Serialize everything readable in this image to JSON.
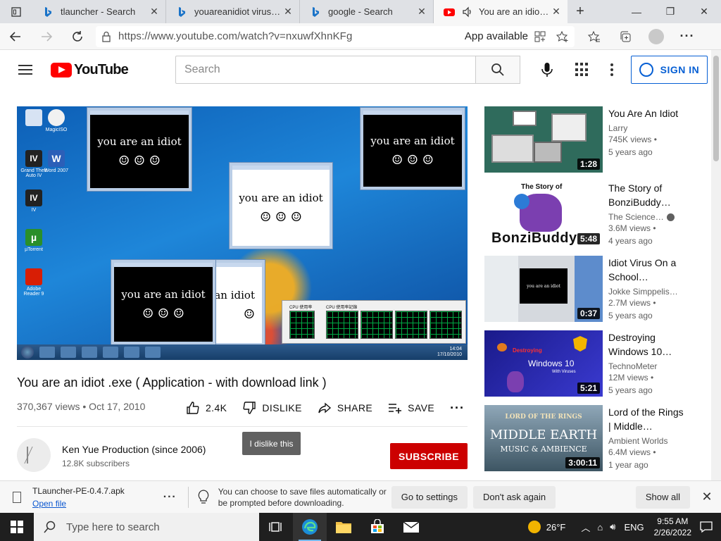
{
  "browser": {
    "tabs": [
      {
        "title": "tlauncher - Search",
        "favicon": "bing-icon",
        "active": false
      },
      {
        "title": "youareanidiot virus dow",
        "favicon": "bing-icon",
        "active": false
      },
      {
        "title": "google - Search",
        "favicon": "bing-icon",
        "active": false
      },
      {
        "title": "You are an idiot .e",
        "favicon": "youtube-icon",
        "active": true
      }
    ],
    "url": "https://www.youtube.com/watch?v=nxuwfXhnKFg",
    "app_available": "App available"
  },
  "youtube": {
    "logo_text": "YouTube",
    "search_placeholder": "Search",
    "sign_in": "SIGN IN",
    "video": {
      "title": "You are an idiot .exe ( Application - with download link )",
      "meta": "370,367 views • Oct 17, 2010",
      "likes": "2.4K",
      "dislike": "DISLIKE",
      "share": "SHARE",
      "save": "SAVE",
      "overlay": {
        "message": "you are an idiot",
        "message_partial": "an idiot",
        "smiles": "☺ ☺ ☺",
        "desktop_icons": [
          "",
          "MagicISO",
          "Grand Theft Auto IV",
          "Word 2007",
          "IV",
          "µTorrent",
          "Adobe Reader 9"
        ],
        "cpu_label_1": "CPU 使用率",
        "cpu_label_2": "CPU 使用率記錄",
        "clock_time": "14:04",
        "clock_date": "17/10/2010"
      }
    },
    "channel": {
      "name": "Ken Yue Production (since 2006)",
      "subs": "12.8K subscribers",
      "subscribe": "SUBSCRIBE"
    },
    "tooltip": "I dislike this",
    "recommendations": [
      {
        "title": "You Are An Idiot",
        "channel": "Larry",
        "views": "745K views •",
        "age": "5 years ago",
        "duration": "1:28",
        "verified": false
      },
      {
        "title": "The Story of BonziBuddy…",
        "channel": "The Science…",
        "views": "3.6M views •",
        "age": "4 years ago",
        "duration": "5:48",
        "verified": true,
        "thumb_text": "BonziBuddy",
        "thumb_sub": "The Story of"
      },
      {
        "title": "Idiot Virus On a School…",
        "channel": "Jokke Simppelis…",
        "views": "2.7M views •",
        "age": "5 years ago",
        "duration": "0:37",
        "verified": false,
        "thumb_text": "you are an idiot"
      },
      {
        "title": "Destroying Windows 10…",
        "channel": "TechnoMeter",
        "views": "12M views •",
        "age": "5 years ago",
        "duration": "5:21",
        "verified": false,
        "thumb_text": "Windows 10",
        "thumb_sub": "Destroying",
        "thumb_sub2": "With Viruses"
      },
      {
        "title": "Lord of the Rings | Middle…",
        "channel": "Ambient Worlds",
        "views": "6.4M views •",
        "age": "1 year ago",
        "duration": "3:00:11",
        "verified": false,
        "thumb_text": "MIDDLE EARTH",
        "thumb_sub": "LORD OF THE RINGS",
        "thumb_sub2": "MUSIC & AMBIENCE"
      }
    ]
  },
  "download_bar": {
    "file_name": "TLauncher-PE-0.4.7.apk",
    "open_file": "Open file",
    "message": "You can choose to save files automatically or be prompted before downloading.",
    "go_to_settings": "Go to settings",
    "dont_ask": "Don't ask again",
    "show_all": "Show all"
  },
  "taskbar": {
    "search_placeholder": "Type here to search",
    "temperature": "26°F",
    "language": "ENG",
    "time": "9:55 AM",
    "date": "2/26/2022"
  },
  "colors": {
    "accent_blue": "#065fd4",
    "subscribe_red": "#cc0000",
    "youtube_red": "#ff0000"
  }
}
